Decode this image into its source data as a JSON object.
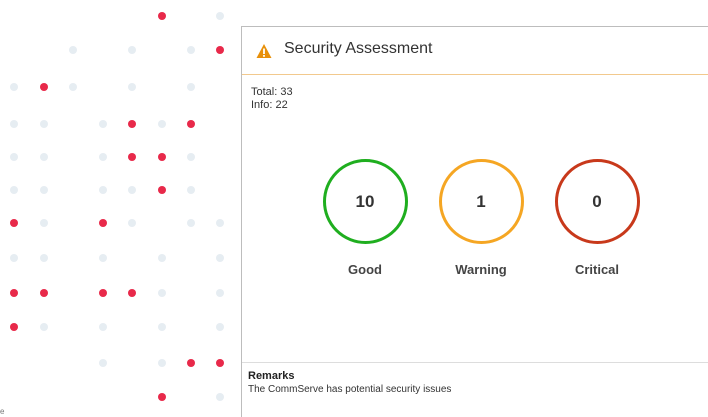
{
  "decoration": {
    "dot_colors": {
      "red": "#e8294a",
      "grey": "#e6edf2"
    },
    "corner_glyph": "e"
  },
  "panel": {
    "icon": "warning-triangle-icon",
    "icon_color": "#e8900a",
    "title": "Security Assessment",
    "header_rule_color": "#f2c98d"
  },
  "counts": {
    "total": "Total: 33",
    "info": "Info: 22"
  },
  "statuses": [
    {
      "key": "good",
      "value": "10",
      "label": "Good",
      "color": "#1fae1f"
    },
    {
      "key": "warning",
      "value": "1",
      "label": "Warning",
      "color": "#f5a623"
    },
    {
      "key": "critical",
      "value": "0",
      "label": "Critical",
      "color": "#c8391b"
    }
  ],
  "remarks": {
    "heading": "Remarks",
    "text": "The CommServe has potential security issues"
  }
}
